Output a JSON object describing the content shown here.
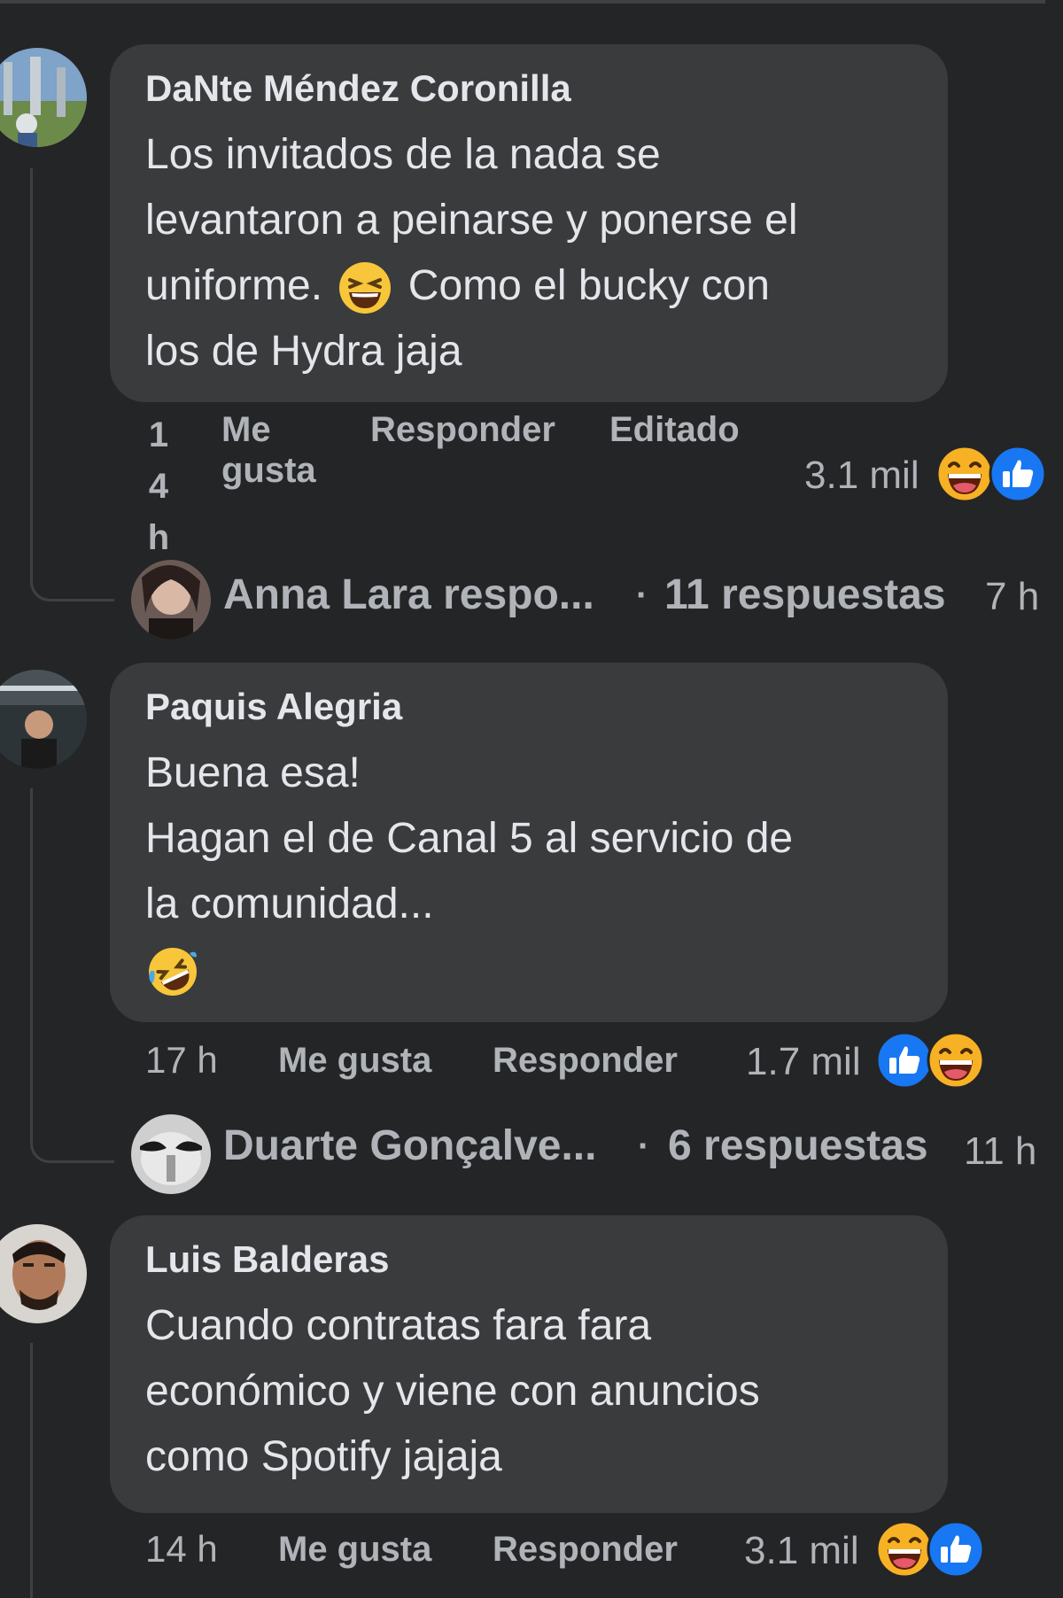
{
  "comments": [
    {
      "author": "DaNte Méndez Coronilla",
      "text": {
        "l1": "Los invitados de la nada se",
        "l2": "levantaron a peinarse y ponerse el",
        "l3a": "uniforme.",
        "l3b": "Como el bucky con",
        "l4": "los de Hydra jaja"
      },
      "time_chars": [
        "1",
        "4",
        "h"
      ],
      "like_label": {
        "l1": "Me",
        "l2": "gusta"
      },
      "reply_label": "Responder",
      "edited_label": "Editado",
      "reaction_count": "3.1 mil",
      "reactions": [
        "haha-icon",
        "like-icon"
      ],
      "reply_summary": {
        "name": "Anna Lara respo...",
        "dot": "·",
        "count": "11 respuestas",
        "time": "7 h"
      }
    },
    {
      "author": "Paquis Alegria",
      "text": {
        "l1": "Buena esa!",
        "l2": "Hagan el de Canal 5 al servicio de",
        "l3": "la comunidad..."
      },
      "time": "17 h",
      "like_label": "Me gusta",
      "reply_label": "Responder",
      "reaction_count": "1.7 mil",
      "reactions": [
        "like-icon",
        "haha-icon"
      ],
      "reply_summary": {
        "name": "Duarte Gonçalve...",
        "dot": "·",
        "count": "6 respuestas",
        "time": "11 h"
      }
    },
    {
      "author": "Luis Balderas",
      "text": {
        "l1": "Cuando contratas fara fara",
        "l2": "económico y viene con anuncios",
        "l3": "como Spotify jajaja"
      },
      "time": "14 h",
      "like_label": "Me gusta",
      "reply_label": "Responder",
      "reaction_count": "3.1 mil",
      "reactions": [
        "haha-icon",
        "like-icon"
      ]
    }
  ],
  "colors": {
    "background": "#242526",
    "bubble": "#3a3b3c",
    "text_primary": "#e4e6eb",
    "text_secondary": "#b0b3b8",
    "like_blue": "#1877f2",
    "haha_yellow": "#f7b125"
  }
}
